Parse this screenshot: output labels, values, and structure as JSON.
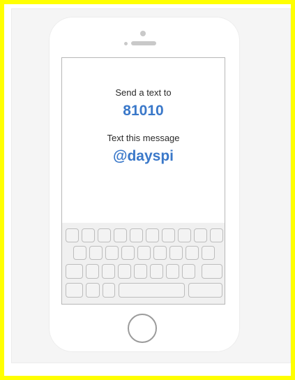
{
  "screen": {
    "send_label": "Send a text to",
    "number": "81010",
    "message_label": "Text this message",
    "message_code": "@dayspi"
  },
  "keyboard": {
    "rows": [
      10,
      9,
      8,
      5
    ]
  }
}
